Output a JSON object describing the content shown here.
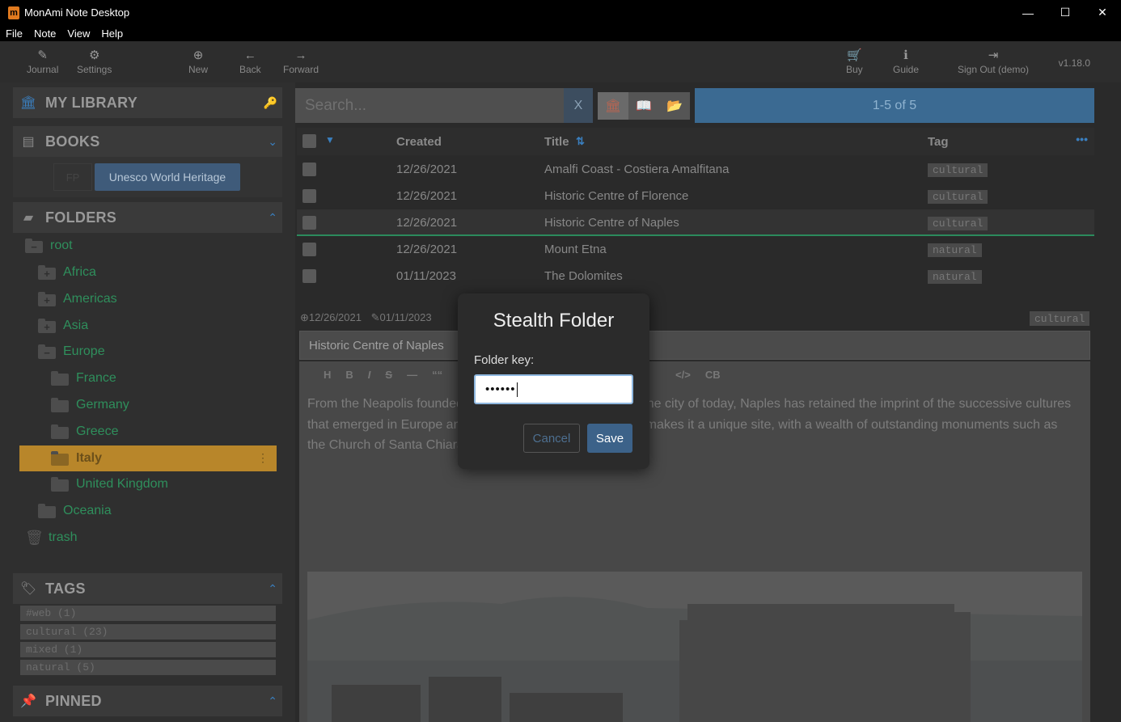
{
  "window": {
    "title": "MonAmi Note Desktop",
    "logo": "m",
    "minimize": "—",
    "maximize": "☐",
    "close": "✕"
  },
  "menu": [
    "File",
    "Note",
    "View",
    "Help"
  ],
  "toolbar": {
    "journal": "Journal",
    "settings": "Settings",
    "new": "New",
    "back": "Back",
    "forward": "Forward",
    "buy": "Buy",
    "guide": "Guide",
    "signout": "Sign Out (demo)",
    "version": "v1.18.0"
  },
  "sidebar": {
    "library": "MY LIBRARY",
    "books": "BOOKS",
    "book_fp": "FP",
    "book_chip": "Unesco World Heritage",
    "folders_label": "FOLDERS",
    "folders": [
      {
        "name": "root",
        "sign": "−"
      },
      {
        "name": "Africa",
        "sign": "+"
      },
      {
        "name": "Americas",
        "sign": "+"
      },
      {
        "name": "Asia",
        "sign": "+"
      },
      {
        "name": "Europe",
        "sign": "−"
      },
      {
        "name": "France",
        "sign": ""
      },
      {
        "name": "Germany",
        "sign": ""
      },
      {
        "name": "Greece",
        "sign": ""
      },
      {
        "name": "Italy",
        "sign": ""
      },
      {
        "name": "United Kingdom",
        "sign": ""
      },
      {
        "name": "Oceania",
        "sign": ""
      },
      {
        "name": "trash",
        "sign": ""
      }
    ],
    "tags_label": "TAGS",
    "tags": [
      "#web (1)",
      "cultural (23)",
      "mixed (1)",
      "natural (5)"
    ],
    "pinned_label": "PINNED"
  },
  "search": {
    "placeholder": "Search...",
    "clear": "X",
    "count": "1-5  of  5"
  },
  "table": {
    "headers": {
      "created": "Created",
      "title": "Title",
      "tag": "Tag"
    },
    "rows": [
      {
        "created": "12/26/2021",
        "title": "Amalfi Coast - Costiera Amalfitana",
        "tag": "cultural"
      },
      {
        "created": "12/26/2021",
        "title": "Historic Centre of Florence",
        "tag": "cultural"
      },
      {
        "created": "12/26/2021",
        "title": "Historic Centre of Naples",
        "tag": "cultural"
      },
      {
        "created": "12/26/2021",
        "title": "Mount Etna",
        "tag": "natural"
      },
      {
        "created": "01/11/2023",
        "title": "The Dolomites",
        "tag": "natural"
      }
    ]
  },
  "note": {
    "created": "12/26/2021",
    "modified": "01/11/2023",
    "tag": "cultural",
    "title": "Historic Centre of Naples",
    "editor_tools": [
      "H",
      "B",
      "I",
      "S",
      "—",
      "““",
      "</>",
      "CB"
    ],
    "body": "From the Neapolis founded by Greek settlers in 470 BC to the city of today, Naples has retained the imprint of the successive cultures that emerged in Europe and the Mediterranean basin. This makes it a unique site, with a wealth of outstanding monuments such as the Church of Santa Chiara and the Castel Nuovo."
  },
  "modal": {
    "title": "Stealth Folder",
    "label": "Folder key:",
    "value": "••••••",
    "cancel": "Cancel",
    "save": "Save"
  },
  "colors": {
    "accent": "#3b6a92",
    "selected_folder": "#b8862a",
    "folder_text": "#2f8f5c"
  }
}
